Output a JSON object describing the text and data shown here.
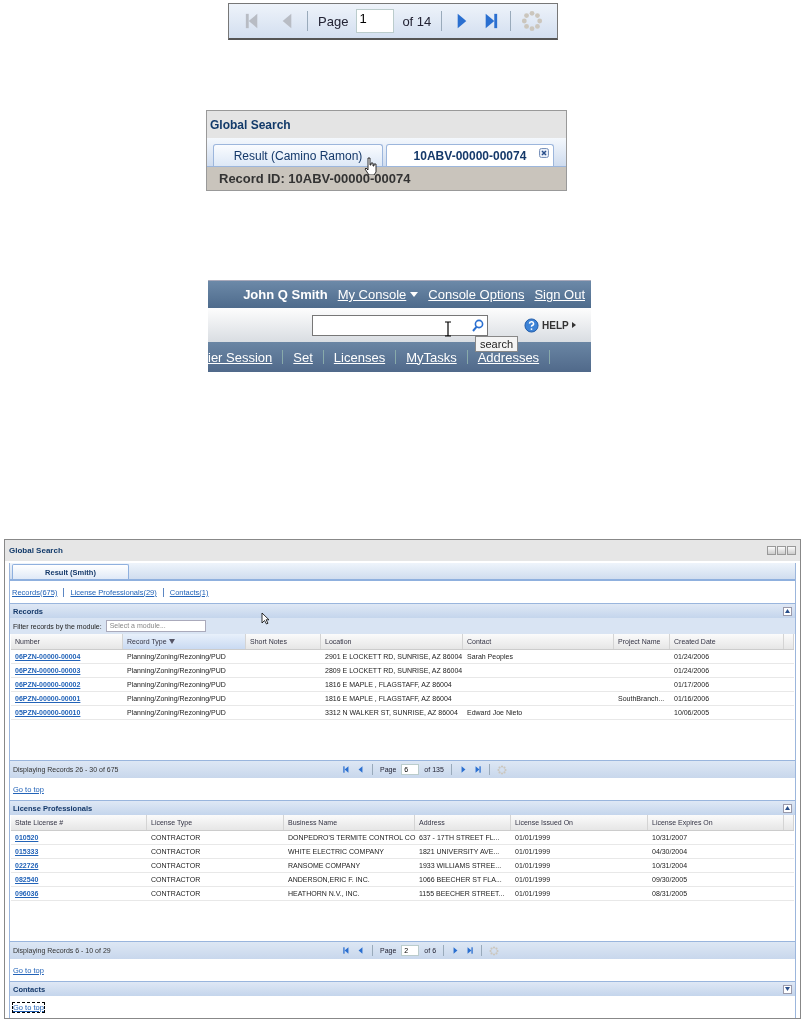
{
  "pager_snippet": {
    "page_label": "Page",
    "page": "1",
    "of": "of 14",
    "at_first": true
  },
  "tab_snippet": {
    "title": "Global Search",
    "tabs": [
      {
        "label": "Result (Camino Ramon)",
        "selected": false,
        "closable": false
      },
      {
        "label": "10ABV-00000-00074",
        "selected": true,
        "closable": true
      }
    ],
    "record_id": "Record ID: 10ABV-00000-00074"
  },
  "header_snippet": {
    "user": "John Q Smith",
    "links": [
      {
        "label": "My Console",
        "dropdown": true
      },
      {
        "label": "Console Options",
        "dropdown": false
      },
      {
        "label": "Sign Out",
        "dropdown": false
      }
    ],
    "search_tooltip": "search",
    "help": "HELP",
    "nav": [
      "ier Session",
      "Set",
      "Licenses",
      "MyTasks",
      "Addresses"
    ]
  },
  "window": {
    "title": "Global Search",
    "tabs": [
      {
        "label": "Result (Smith)",
        "selected": true
      }
    ],
    "links": [
      "Records(675)",
      "License Professionals(29)",
      "Contacts(1)"
    ],
    "sections": [
      {
        "title": "Records",
        "expanded": true,
        "filter": {
          "label": "Filter records by the module:",
          "placeholder": "Select a module..."
        },
        "columns": [
          {
            "label": "Number",
            "sorted": false
          },
          {
            "label": "Record Type",
            "sorted": true
          },
          {
            "label": "Short Notes",
            "sorted": false
          },
          {
            "label": "Location",
            "sorted": false
          },
          {
            "label": "Contact",
            "sorted": false
          },
          {
            "label": "Project Name",
            "sorted": false
          },
          {
            "label": "Created Date",
            "sorted": false
          }
        ],
        "rows": [
          [
            "06PZN-00000-00004",
            "Planning/Zoning/Rezoning/PUD",
            "",
            "2901 E LOCKETT RD, SUNRISE, AZ 86004",
            "Sarah Peoples",
            "",
            "01/24/2006"
          ],
          [
            "06PZN-00000-00003",
            "Planning/Zoning/Rezoning/PUD",
            "",
            "2809 E LOCKETT RD, SUNRISE, AZ 86004",
            "",
            "",
            "01/24/2006"
          ],
          [
            "06PZN-00000-00002",
            "Planning/Zoning/Rezoning/PUD",
            "",
            "1816 E MAPLE , FLAGSTAFF, AZ 86004",
            "",
            "",
            "01/17/2006"
          ],
          [
            "06PZN-00000-00001",
            "Planning/Zoning/Rezoning/PUD",
            "",
            "1816 E MAPLE , FLAGSTAFF, AZ 86004",
            "",
            "SouthBranch...",
            "01/16/2006"
          ],
          [
            "05PZN-00000-00010",
            "Planning/Zoning/Rezoning/PUD",
            "",
            "3312 N WALKER ST, SUNRISE, AZ 86004",
            "Edward Joe Nieto",
            "",
            "10/06/2005"
          ]
        ],
        "footer": "Displaying Records 26 - 30 of 675",
        "pager": {
          "page_label": "Page",
          "page": "6",
          "of": "of 135",
          "at_first": false
        },
        "go_to_top": "Go to top"
      },
      {
        "title": "License Professionals",
        "expanded": true,
        "columns": [
          {
            "label": "State License #",
            "sorted": false
          },
          {
            "label": "License Type",
            "sorted": false
          },
          {
            "label": "Business Name",
            "sorted": false
          },
          {
            "label": "Address",
            "sorted": false
          },
          {
            "label": "License Issued On",
            "sorted": false
          },
          {
            "label": "License Expires On",
            "sorted": false
          }
        ],
        "rows": [
          [
            "010520",
            "CONTRACTOR",
            "DONPEDRO'S TERMITE CONTROL CO",
            "637 - 17TH STREET FL...",
            "01/01/1999",
            "10/31/2007"
          ],
          [
            "015333",
            "CONTRACTOR",
            "WHITE ELECTRIC COMPANY",
            "1821 UNIVERSITY AVE...",
            "01/01/1999",
            "04/30/2004"
          ],
          [
            "022726",
            "CONTRACTOR",
            "RANSOME COMPANY",
            "1933 WILLIAMS STREE...",
            "01/01/1999",
            "10/31/2004"
          ],
          [
            "082540",
            "CONTRACTOR",
            "ANDERSON,ERIC F. INC.",
            "1066 BEECHER ST FLA...",
            "01/01/1999",
            "09/30/2005"
          ],
          [
            "096036",
            "CONTRACTOR",
            "HEATHORN N.V., INC.",
            "1155 BEECHER STREET...",
            "01/01/1999",
            "08/31/2005"
          ]
        ],
        "footer": "Displaying Records 6 - 10 of 29",
        "pager": {
          "page_label": "Page",
          "page": "2",
          "of": "of 6",
          "at_first": false
        },
        "go_to_top": "Go to top"
      },
      {
        "title": "Contacts",
        "expanded": false,
        "go_to_top": "Go to top"
      }
    ]
  }
}
